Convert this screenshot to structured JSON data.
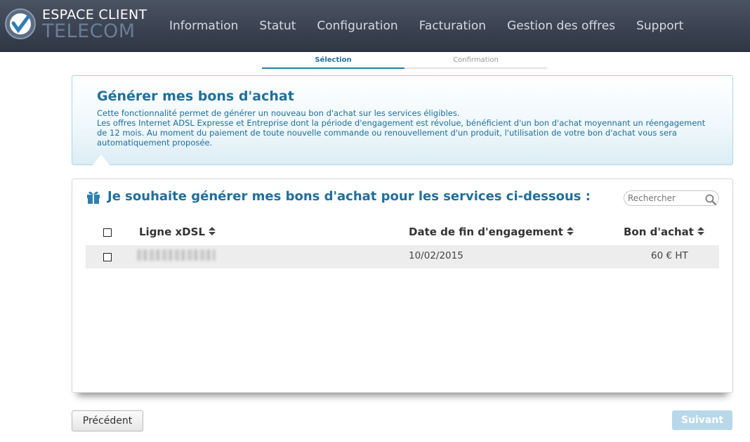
{
  "header": {
    "logo_line1": "ESPACE CLIENT",
    "logo_line2": "TELECOM",
    "nav": [
      "Information",
      "Statut",
      "Configuration",
      "Facturation",
      "Gestion des offres",
      "Support"
    ]
  },
  "steps": [
    "Sélection",
    "Confirmation"
  ],
  "info": {
    "title": "Générer mes bons d'achat",
    "text1": "Cette fonctionnalité permet de générer un nouveau bon d'achat sur les services éligibles.",
    "text2": "Les offres Internet ADSL Expresse et Entreprise dont la période d'engagement est révolue, bénéficient d'un bon d'achat moyennant un réengagement de 12 mois. Au moment du paiement de toute nouvelle commande ou renouvellement d'un produit, l'utilisation de votre bon d'achat vous sera automatiquement proposée."
  },
  "card": {
    "title": "Je souhaite générer mes bons d'achat pour les services ci-dessous :",
    "search_placeholder": "Rechercher",
    "columns": [
      "Ligne xDSL",
      "Date de fin d'engagement",
      "Bon d'achat"
    ],
    "rows": [
      {
        "line": "",
        "end_date": "10/02/2015",
        "voucher": "60 € HT"
      }
    ]
  },
  "buttons": {
    "previous": "Précédent",
    "next": "Suivant"
  },
  "colors": {
    "header_bg": "#3a4250",
    "accent": "#1f6f9c",
    "next_disabled": "#b8d8ea"
  }
}
